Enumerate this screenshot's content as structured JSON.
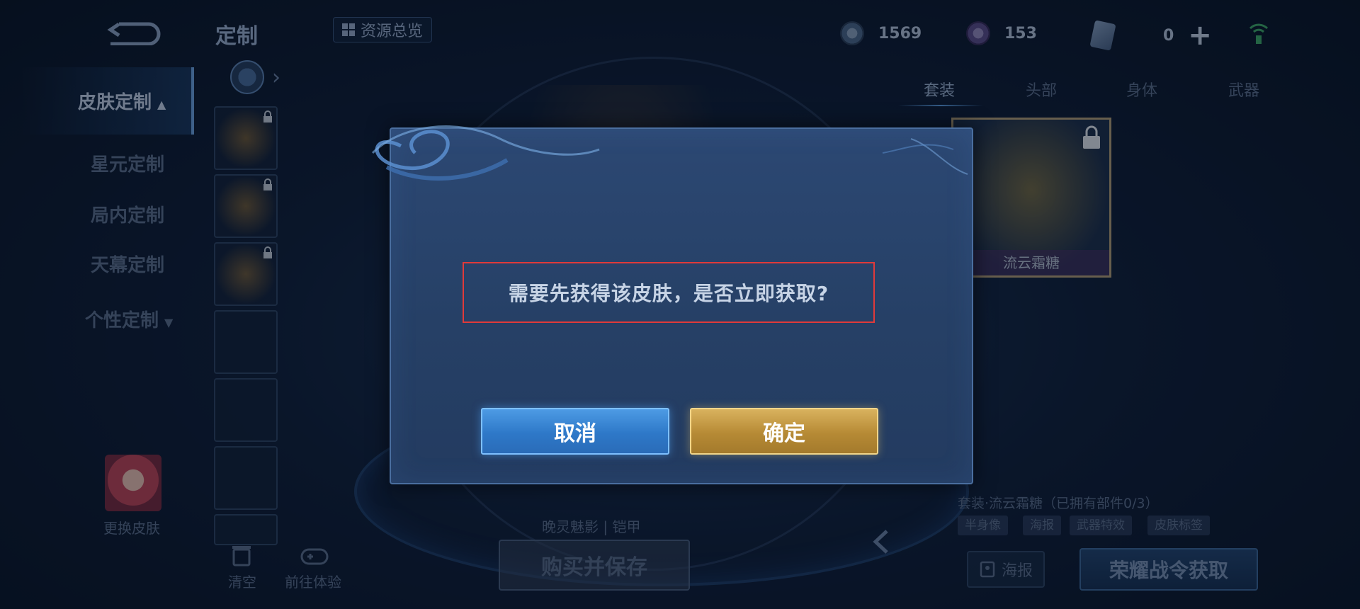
{
  "header": {
    "title": "定制",
    "resource_overview": "资源总览",
    "currencies": [
      {
        "icon": "coin-icon",
        "value": "1569"
      },
      {
        "icon": "diamond-coin-icon",
        "value": "153"
      },
      {
        "icon": "card-icon",
        "value": "0"
      }
    ]
  },
  "left_nav": {
    "items": [
      {
        "label": "皮肤定制",
        "active": true
      },
      {
        "label": "星元定制"
      },
      {
        "label": "局内定制"
      },
      {
        "label": "天幕定制"
      },
      {
        "label": "个性定制"
      }
    ],
    "change_skin": "更换皮肤",
    "clear": "清空",
    "try_out": "前往体验"
  },
  "center": {
    "hero_name": "晚灵魅影 | 铠甲",
    "buy_button": "购买并保存"
  },
  "right_panel": {
    "tabs": [
      "套装",
      "头部",
      "身体",
      "武器"
    ],
    "skin_card_name": "流云霜糖",
    "set_info": "套装·流云霜糖（已拥有部件0/3）",
    "tags": [
      "半身像",
      "海报",
      "武器特效",
      "皮肤标签"
    ],
    "poster_button": "海报",
    "battle_pass_button": "荣耀战令获取"
  },
  "dialog": {
    "message": "需要先获得该皮肤，是否立即获取?",
    "cancel_label": "取消",
    "confirm_label": "确定"
  }
}
